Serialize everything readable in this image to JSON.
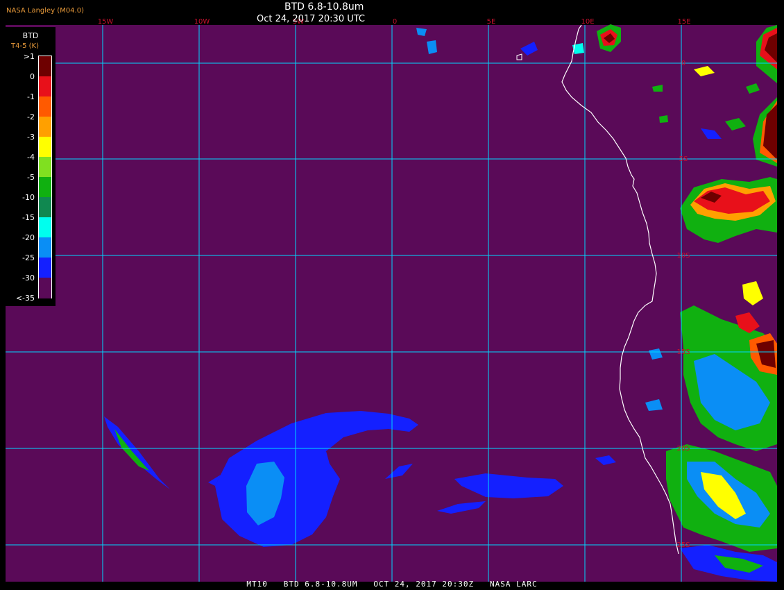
{
  "header": {
    "credit": "NASA Langley (M04.0)",
    "title": "BTD 6.8-10.8um",
    "datetime": "Oct 24, 2017 20:30 UTC"
  },
  "footer": {
    "text": "MT10   BTD 6.8-10.8UM   OCT 24, 2017 20:30Z   NASA LARC"
  },
  "legend": {
    "title": "BTD",
    "unit": "T4-5 (K)",
    "ticks": [
      ">1",
      "0",
      "-1",
      "-2",
      "-3",
      "-4",
      "-5",
      "-10",
      "-15",
      "-20",
      "-25",
      "-30",
      "<-35"
    ],
    "colors": [
      "#6e0000",
      "#e8101a",
      "#ff5a00",
      "#ffa000",
      "#ffff00",
      "#80e020",
      "#10b010",
      "#108850",
      "#00ffee",
      "#0a8ef5",
      "#1420ff",
      "#5a0a58"
    ]
  },
  "map": {
    "lon_labels": [
      "15W",
      "10W",
      "5W",
      "0",
      "5E",
      "10E",
      "15E"
    ],
    "lat_labels": [
      "0",
      "5S",
      "10S",
      "15S",
      "20S",
      "25S"
    ],
    "colors": {
      "background": "#5a0a58",
      "grid": "#00d8ff",
      "coast": "#ffffff",
      "cloud_blue": "#1420ff",
      "cloud_light": "#0a8ef5"
    }
  }
}
